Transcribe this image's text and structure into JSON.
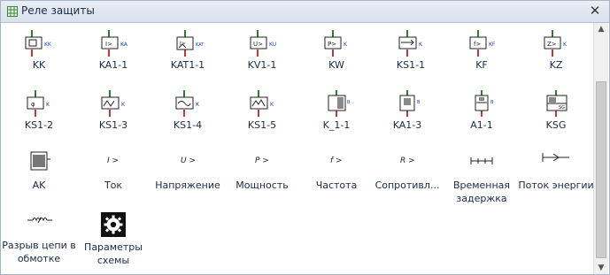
{
  "window": {
    "title": "Реле защиты",
    "close": "✕"
  },
  "scrollbar": {
    "up": "▲",
    "down": "▼"
  },
  "items": [
    {
      "label": "KK",
      "tag": "KK"
    },
    {
      "label": "KA1-1",
      "tag": "KA"
    },
    {
      "label": "KAT1-1",
      "tag": "KAT"
    },
    {
      "label": "KV1-1",
      "tag": "KU"
    },
    {
      "label": "KW",
      "tag": "K"
    },
    {
      "label": "KS1-1",
      "tag": "K"
    },
    {
      "label": "KF",
      "tag": "KF"
    },
    {
      "label": "KZ",
      "tag": "K"
    },
    {
      "label": "KS1-2",
      "tag": "K"
    },
    {
      "label": "KS1-3",
      "tag": "K"
    },
    {
      "label": "KS1-4",
      "tag": "K"
    },
    {
      "label": "KS1-5",
      "tag": "K"
    },
    {
      "label": "K_1-1",
      "tag": "B"
    },
    {
      "label": "KA1-3",
      "tag": "B"
    },
    {
      "label": "A1-1",
      "tag": "B"
    },
    {
      "label": "KSG",
      "tag": ""
    },
    {
      "label": "AK",
      "tag": ""
    },
    {
      "label": "Ток",
      "sym": "I >"
    },
    {
      "label": "Напряжение",
      "sym": "U >"
    },
    {
      "label": "Мощность",
      "sym": "P >"
    },
    {
      "label": "Частота",
      "sym": "f >"
    },
    {
      "label": "Сопротивл...",
      "sym": "R >"
    },
    {
      "label": "Временная задержка",
      "sym": ""
    },
    {
      "label": "Поток энергии",
      "sym": ""
    },
    {
      "label": "Разрыв цепи в обмотке",
      "sym": ""
    },
    {
      "label": "Параметры схемы",
      "sym": ""
    }
  ]
}
